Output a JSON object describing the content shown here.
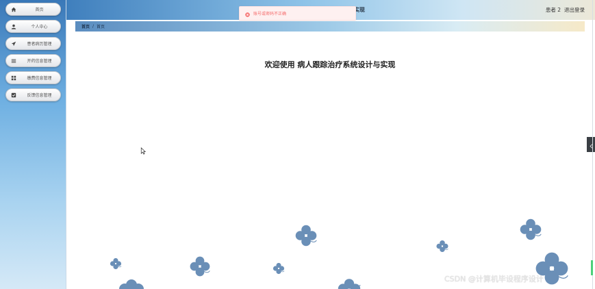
{
  "sidebar": {
    "items": [
      {
        "label": "首页",
        "icon": "home-icon"
      },
      {
        "label": "个人中心",
        "icon": "user-icon"
      },
      {
        "label": "患者病历管理",
        "icon": "send-icon"
      },
      {
        "label": "开药信息管理",
        "icon": "list-icon"
      },
      {
        "label": "缴费信息管理",
        "icon": "grid-icon"
      },
      {
        "label": "反馈信息管理",
        "icon": "checkbox-icon"
      }
    ]
  },
  "header": {
    "title_visible": "实现",
    "user_name": "患者 2",
    "logout": "退出登录"
  },
  "message": {
    "text": "账号或密码不正确",
    "type": "error"
  },
  "breadcrumb": {
    "home": "首页",
    "separator": "/",
    "current": "首页"
  },
  "main": {
    "welcome": "欢迎使用 病人跟踪治疗系统设计与实现"
  },
  "watermark": "CSDN @计算机毕设程序设计",
  "colors": {
    "flower": "#6a8fb7",
    "error": "#f56c6c",
    "header_start": "#3f7fbd"
  }
}
